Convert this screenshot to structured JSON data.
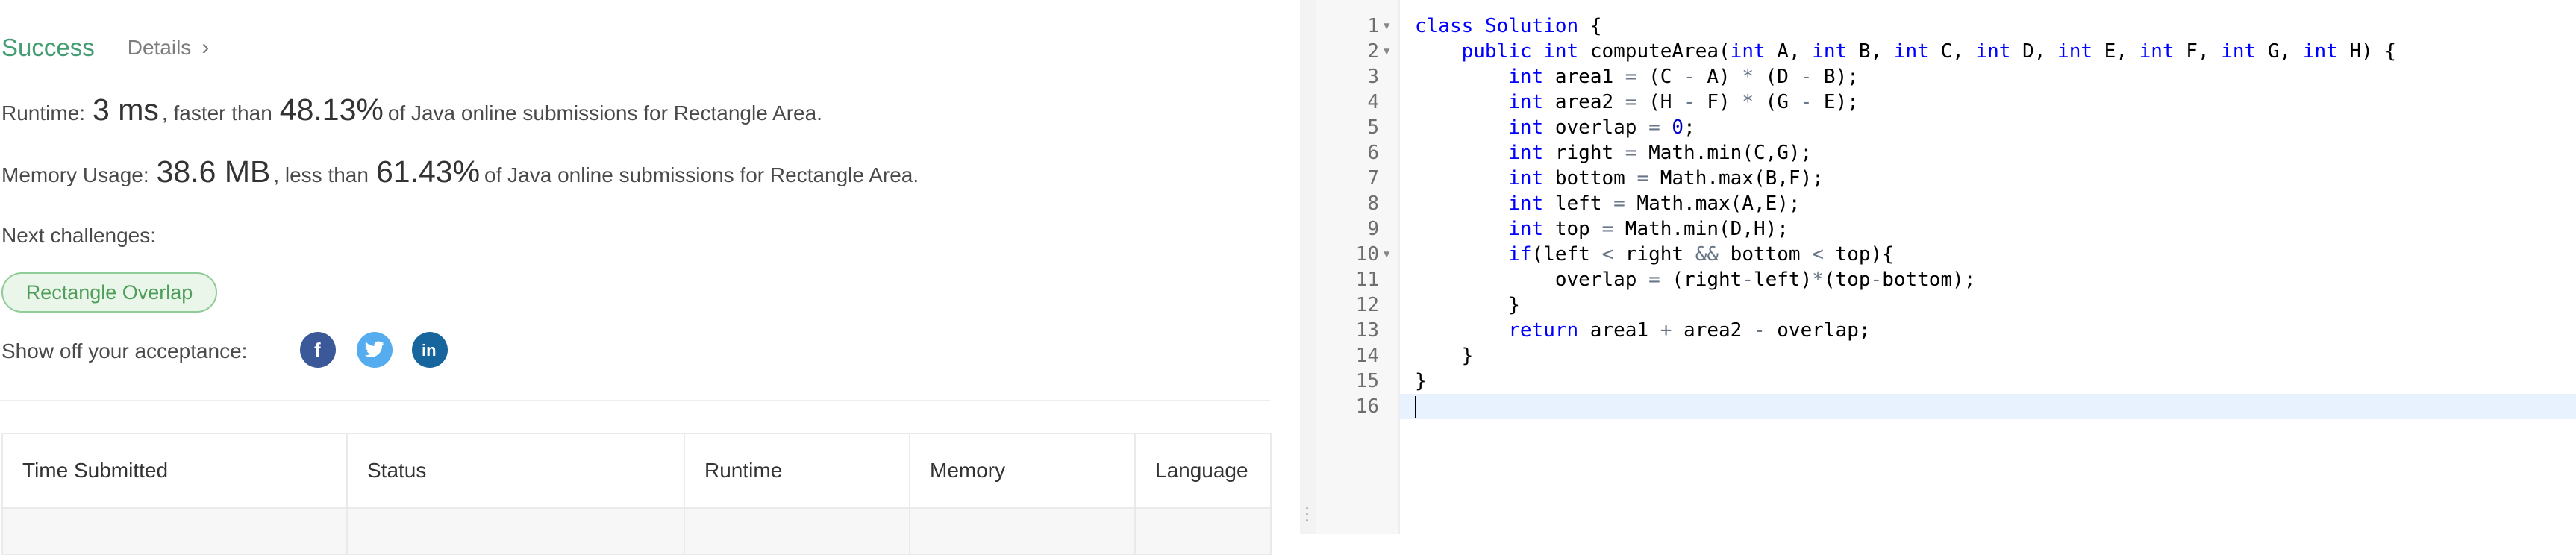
{
  "result": {
    "status": "Success",
    "details_label": "Details",
    "runtime_prefix": "Runtime:",
    "runtime_value": "3 ms",
    "runtime_mid": ", faster than",
    "runtime_pct": "48.13%",
    "runtime_suffix": "of Java online submissions for Rectangle Area.",
    "memory_prefix": "Memory Usage:",
    "memory_value": "38.6 MB",
    "memory_mid": ", less than",
    "memory_pct": "61.43%",
    "memory_suffix": "of Java online submissions for Rectangle Area.",
    "next_label": "Next challenges:",
    "challenge": "Rectangle Overlap",
    "share_label": "Show off your acceptance:"
  },
  "icons": {
    "facebook": "facebook-icon",
    "twitter": "twitter-icon",
    "linkedin": "linkedin-icon",
    "details_chevron": "chevron-right-icon"
  },
  "table": {
    "headers": [
      "Time Submitted",
      "Status",
      "Runtime",
      "Memory",
      "Language"
    ]
  },
  "editor": {
    "line_numbers": [
      "1",
      "2",
      "3",
      "4",
      "5",
      "6",
      "7",
      "8",
      "9",
      "10",
      "11",
      "12",
      "13",
      "14",
      "15",
      "16"
    ],
    "fold_lines": [
      "1",
      "2",
      "10"
    ],
    "lines": [
      "class Solution {",
      "    public int computeArea(int A, int B, int C, int D, int E, int F, int G, int H) {",
      "        int area1 = (C - A) * (D - B);",
      "        int area2 = (H - F) * (G - E);",
      "        int overlap = 0;",
      "        int right = Math.min(C,G);",
      "        int bottom = Math.max(B,F);",
      "        int left = Math.max(A,E);",
      "        int top = Math.min(D,H);",
      "        if(left < right && bottom < top){",
      "            overlap = (right-left)*(top-bottom);",
      "        }",
      "        return area1 + area2 - overlap;",
      "    }",
      "}",
      ""
    ]
  },
  "colors": {
    "success": "#449d73",
    "keyword": "#0000ff",
    "operator": "#687687",
    "active_line": "#e8f2ff"
  }
}
